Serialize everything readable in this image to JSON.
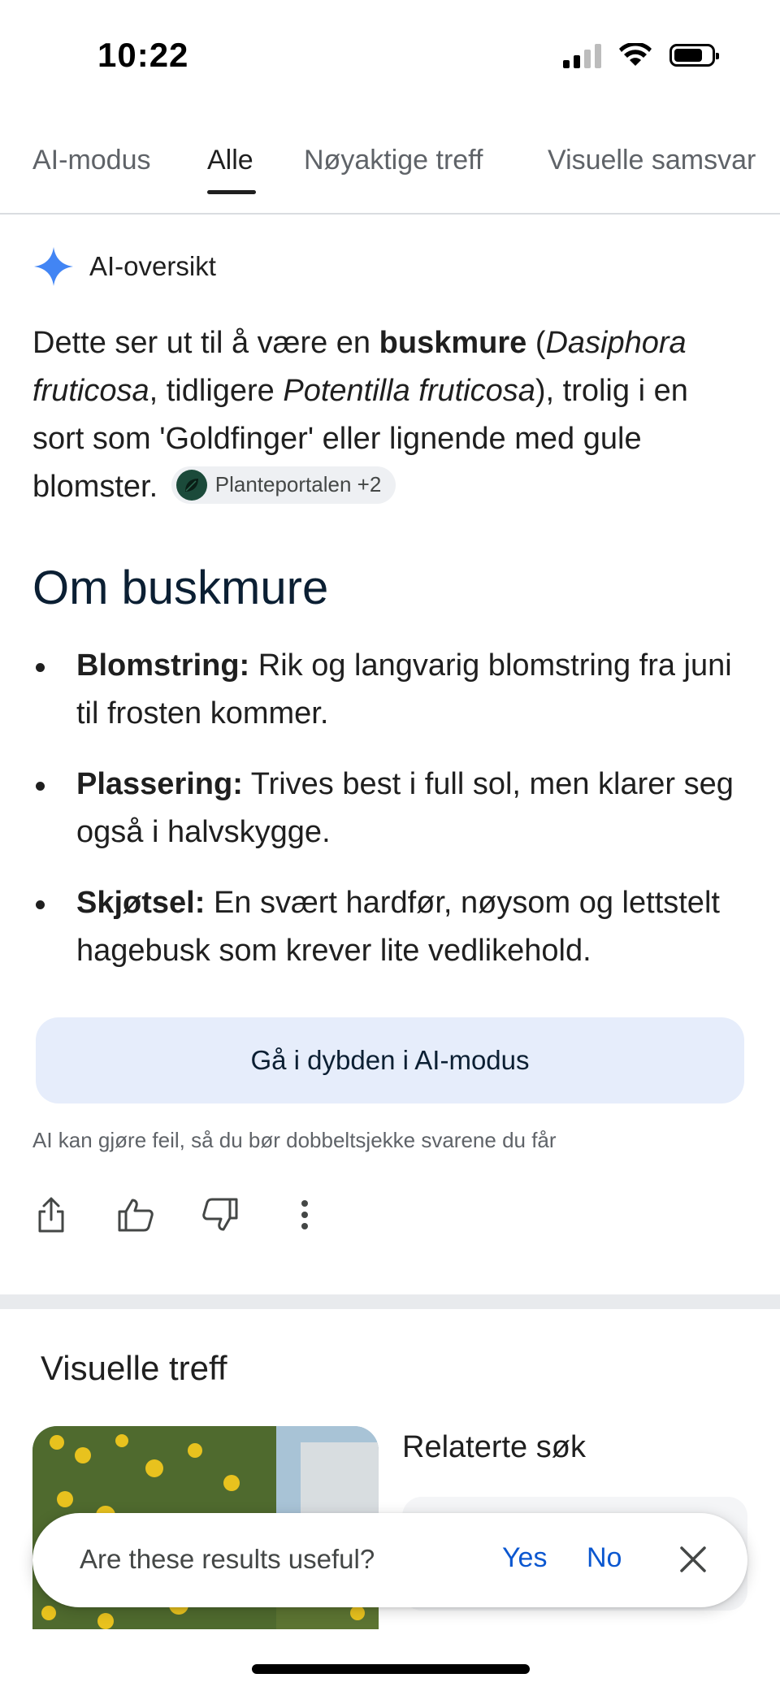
{
  "status_bar": {
    "time": "10:22"
  },
  "tabs": [
    {
      "label": "AI-modus"
    },
    {
      "label": "Alle",
      "active": true
    },
    {
      "label": "Nøyaktige treff"
    },
    {
      "label": "Visuelle samsvar"
    }
  ],
  "ai_overview": {
    "header": "AI-oversikt",
    "intro_1": "Dette ser ut til å være en ",
    "intro_bold": "buskmure",
    "intro_2": " (",
    "intro_italic_1": "Dasiphora fruticosa",
    "intro_3": ", tidligere ",
    "intro_italic_2": "Potentilla fruticosa",
    "intro_4": "), trolig i en sort som 'Goldfinger' eller lignende med gule blomster.",
    "source_chip": "Planteportalen +2",
    "section_title": "Om buskmure",
    "bullets": [
      {
        "label": "Blomstring:",
        "text": " Rik og langvarig blomstring fra juni til frosten kommer."
      },
      {
        "label": "Plassering:",
        "text": " Trives best i full sol, men klarer seg også i halvskygge."
      },
      {
        "label": "Skjøtsel:",
        "text": " En svært hardfør, nøysom og lettstelt hagebusk som krever lite vedlikehold."
      }
    ],
    "deep_dive_button": "Gå i dybden i AI-modus",
    "disclaimer": "AI kan gjøre feil, så du bør dobbeltsjekke svarene du får"
  },
  "visual_matches": {
    "title": "Visuelle treff"
  },
  "related": {
    "title": "Relaterte søk"
  },
  "feedback": {
    "question": "Are these results useful?",
    "yes": "Yes",
    "no": "No"
  },
  "colors": {
    "accent_blue": "#0b57d0",
    "sparkle_blue": "#4285f4",
    "button_bg": "#e6edfb"
  }
}
